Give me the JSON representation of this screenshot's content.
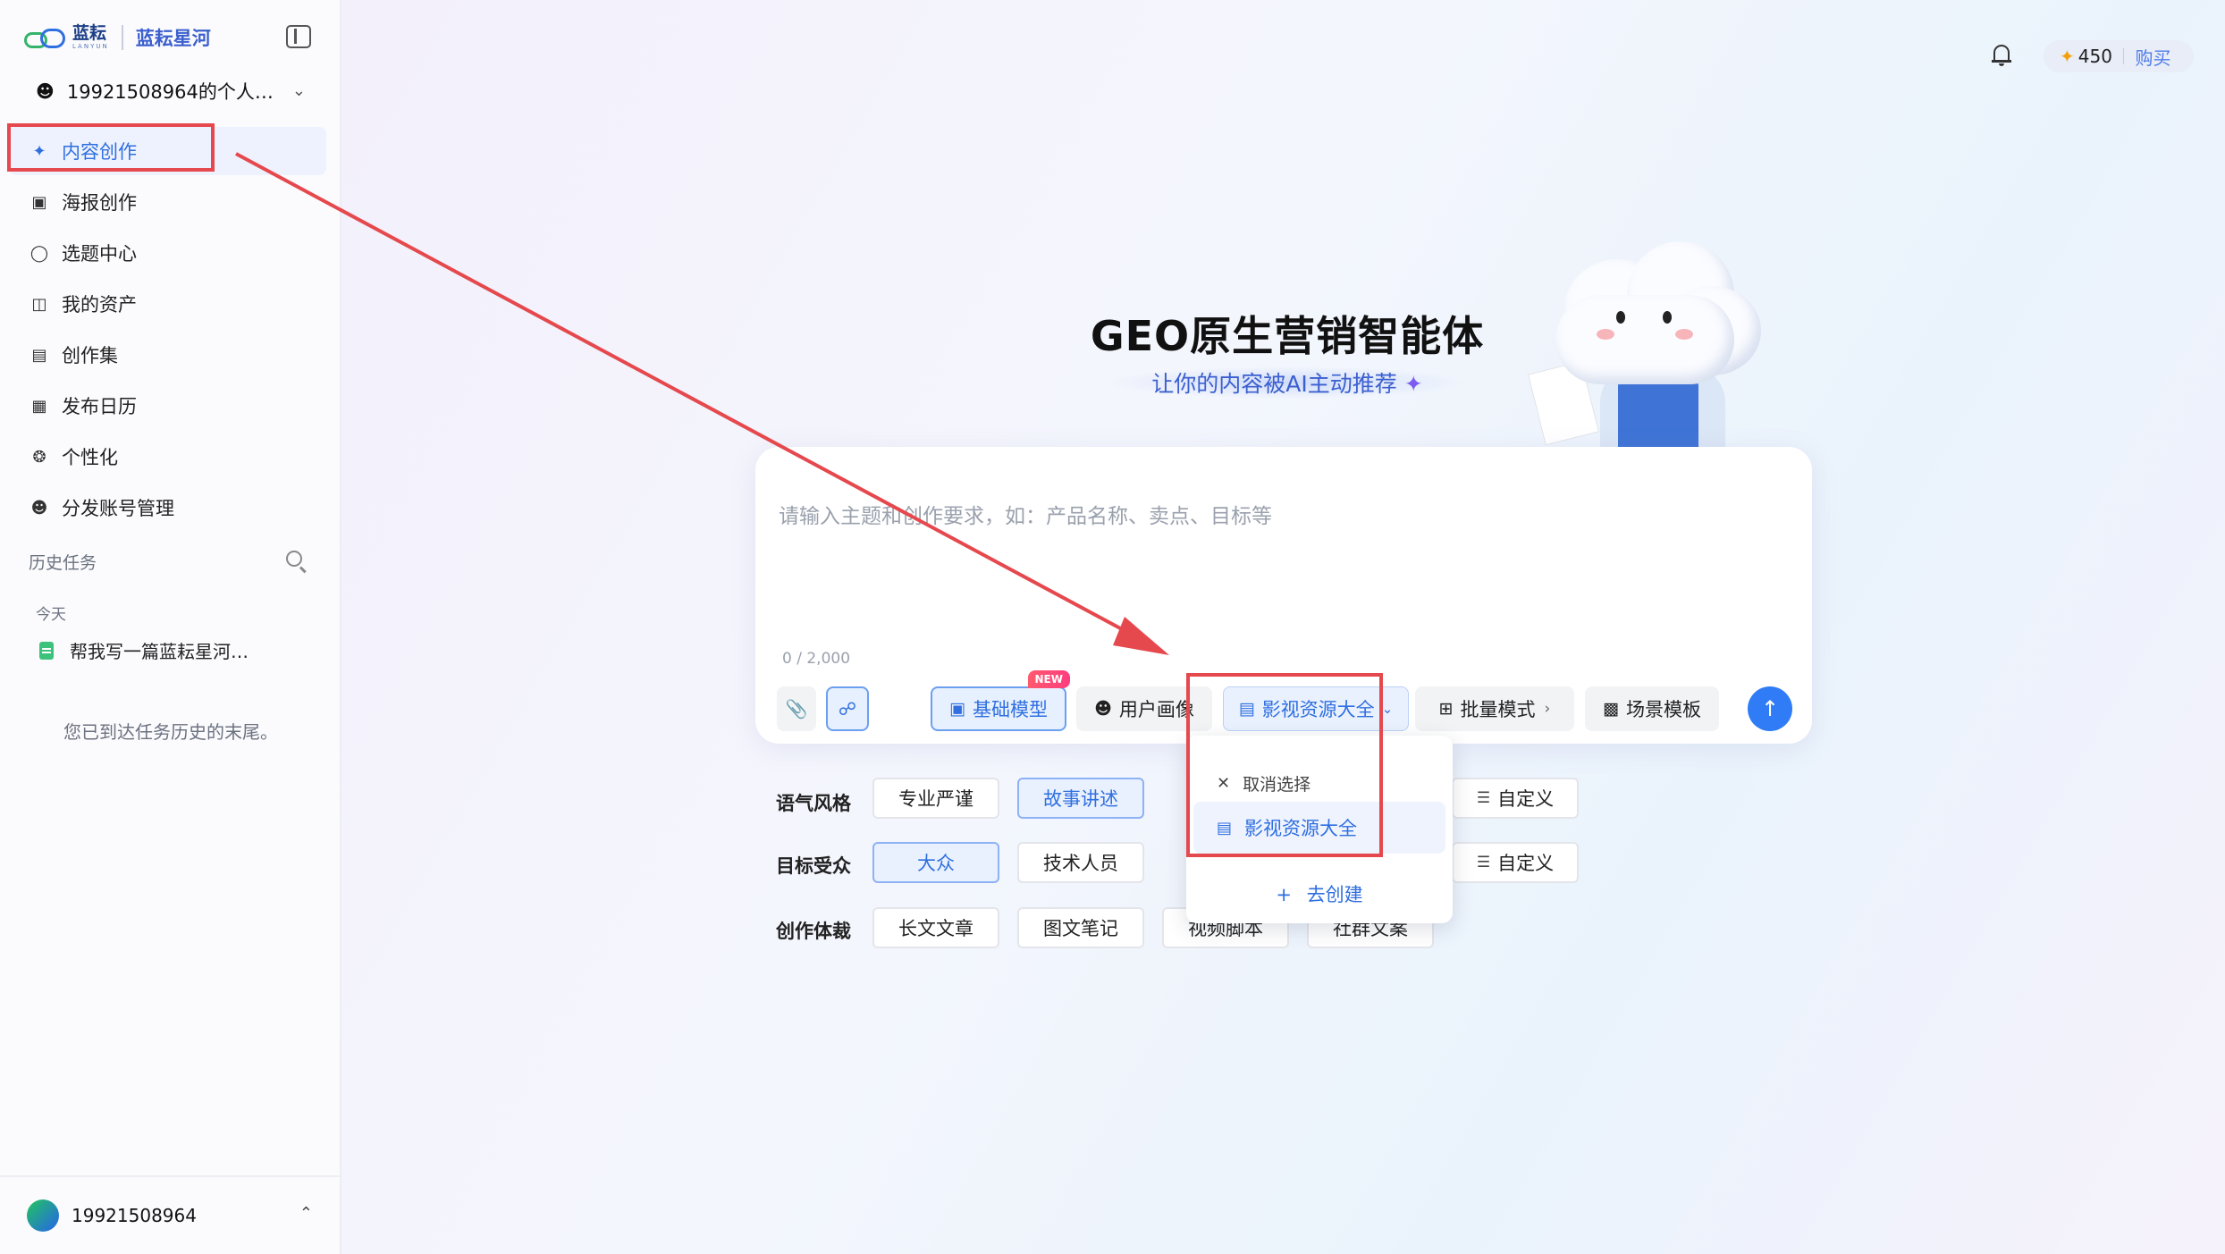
{
  "brand": {
    "logo_cn": "蓝耘",
    "logo_en": "LANYUN",
    "product": "蓝耘星河"
  },
  "account": {
    "name": "19921508964的个人…"
  },
  "nav": [
    {
      "label": "内容创作",
      "icon": "sparkle-pen-icon",
      "active": true
    },
    {
      "label": "海报创作",
      "icon": "image-icon"
    },
    {
      "label": "选题中心",
      "icon": "chat-bubble-icon"
    },
    {
      "label": "我的资产",
      "icon": "inbox-icon"
    },
    {
      "label": "创作集",
      "icon": "folder-icon"
    },
    {
      "label": "发布日历",
      "icon": "calendar-icon"
    },
    {
      "label": "个性化",
      "icon": "palette-icon"
    },
    {
      "label": "分发账号管理",
      "icon": "user-icon"
    }
  ],
  "history": {
    "title": "历史任务",
    "today": "今天",
    "items": [
      "帮我写一篇蓝耘星河…"
    ],
    "end_note": "您已到达任务历史的末尾。"
  },
  "user": {
    "name": "19921508964"
  },
  "header": {
    "credits": "450",
    "buy": "购买"
  },
  "hero": {
    "title": "GEO原生营销智能体",
    "subtitle": "让你的内容被AI主动推荐"
  },
  "input": {
    "placeholder": "请输入主题和创作要求，如：产品名称、卖点、目标等",
    "counter": "0 / 2,000"
  },
  "toolbar": {
    "model": "基础模型",
    "new_badge": "NEW",
    "persona": "用户画像",
    "resource": "影视资源大全",
    "batch": "批量模式",
    "scene": "场景模板"
  },
  "options": {
    "tone": {
      "label": "语气风格",
      "items": [
        "专业严谨",
        "故事讲述"
      ],
      "selected": "故事讲述",
      "custom": "自定义"
    },
    "audience": {
      "label": "目标受众",
      "items": [
        "大众",
        "技术人员"
      ],
      "selected": "大众",
      "custom": "自定义"
    },
    "genre": {
      "label": "创作体裁",
      "items": [
        "长文文章",
        "图文笔记",
        "视频脚本",
        "社群文案"
      ]
    }
  },
  "dropdown": {
    "cancel": "取消选择",
    "selected_item": "影视资源大全",
    "create": "去创建"
  },
  "colors": {
    "accent": "#2f6fe0",
    "annotation": "#e5484d",
    "send": "#2f7cf6"
  }
}
